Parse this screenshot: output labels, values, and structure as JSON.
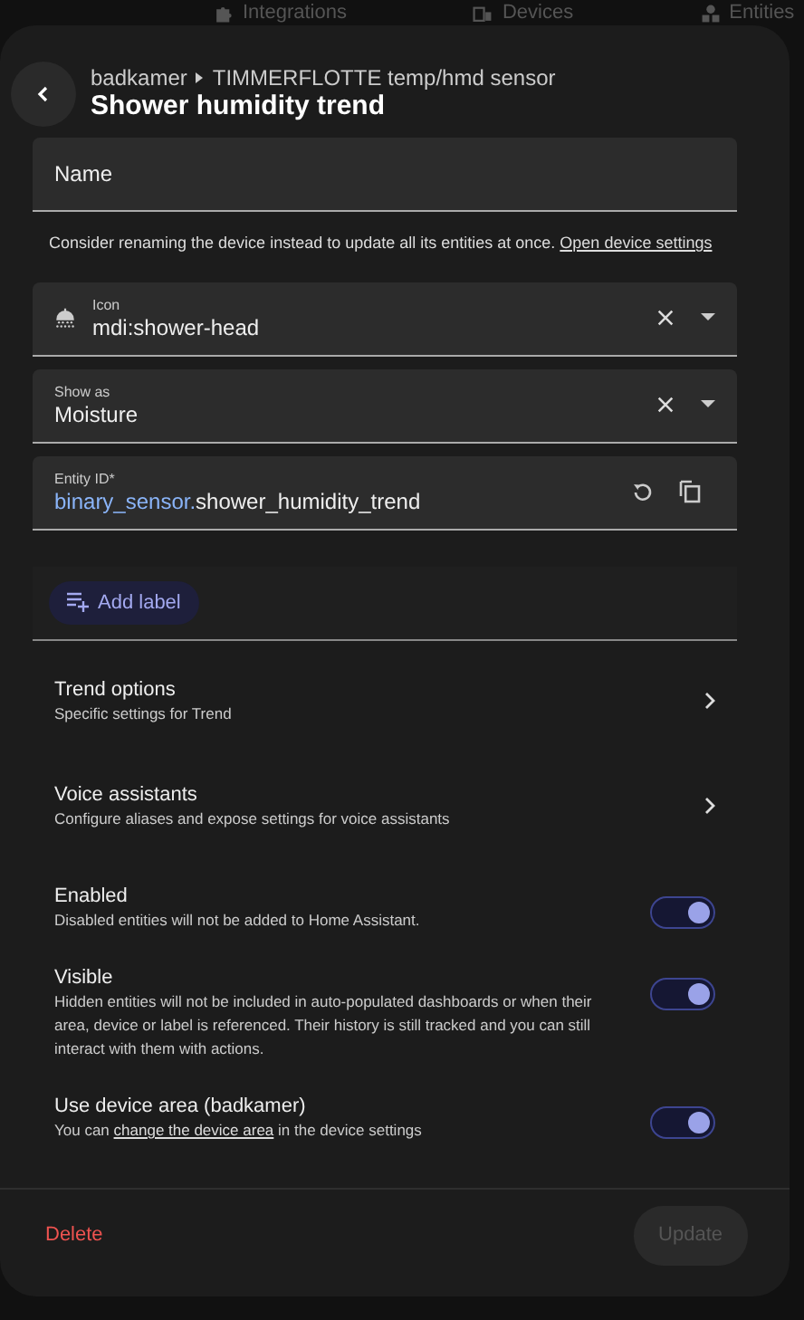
{
  "background_tabs": [
    {
      "label": "Integrations"
    },
    {
      "label": "Devices"
    },
    {
      "label": "Entities"
    }
  ],
  "dialog": {
    "breadcrumb": [
      "badkamer",
      "TIMMERFLOTTE temp/hmd sensor"
    ],
    "title": "Shower humidity trend"
  },
  "name_field": {
    "label": "Name",
    "helper": {
      "text": "Consider renaming the device instead to update all its entities at once.",
      "link": "Open device settings"
    }
  },
  "fields": [
    {
      "kind": "icon_select",
      "label": "Icon",
      "value": "mdi:shower-head"
    },
    {
      "kind": "select",
      "label": "Show as",
      "value": "Moisture"
    },
    {
      "kind": "entity",
      "label": "Entity ID*",
      "value_prefix": "binary_sensor.",
      "value": "shower_humidity_trend"
    }
  ],
  "add_label": "Add label",
  "links": [
    {
      "title": "Trend options",
      "subtitle": "Specific settings for Trend"
    },
    {
      "title": "Voice assistants",
      "subtitle": "Configure aliases and expose settings for voice assistants"
    }
  ],
  "switches": [
    {
      "title": "Enabled",
      "description": "Disabled entities will not be added to Home Assistant.",
      "on": true
    },
    {
      "title": "Visible",
      "description": "Hidden entities will not be included in auto-populated dashboards or when their area, device or label is referenced. Their history is still tracked and you can still interact with them with actions.",
      "on": true
    },
    {
      "title": "Use device area (badkamer)",
      "description_before": "You can",
      "link": "change the device area",
      "description_after": "in the device settings",
      "on": true
    }
  ],
  "footer": {
    "delete": "Delete",
    "update": {
      "label": "Update",
      "disabled": true
    }
  }
}
